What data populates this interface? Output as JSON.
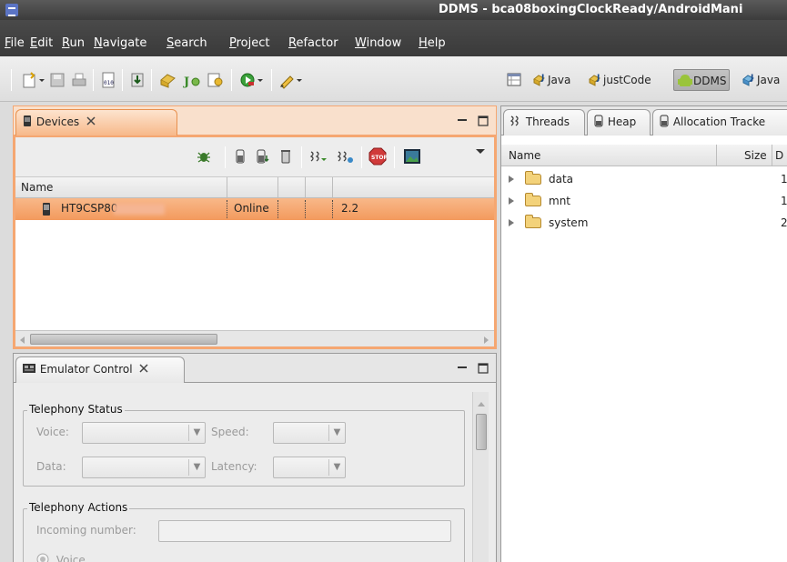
{
  "window": {
    "title": "DDMS - bca08boxingClockReady/AndroidMani"
  },
  "menu": [
    "File",
    "Edit",
    "Run",
    "Navigate",
    "Search",
    "Project",
    "Refactor",
    "Window",
    "Help"
  ],
  "perspectives": [
    "Java",
    "justCode",
    "DDMS",
    "Java"
  ],
  "devices_view": {
    "tab_label": "Devices",
    "column_name": "Name",
    "device": {
      "serial": "HT9CSP80",
      "state": "Online",
      "build": "2.2"
    }
  },
  "emulator_view": {
    "tab_label": "Emulator Control",
    "telephony_status_label": "Telephony Status",
    "voice_label": "Voice:",
    "speed_label": "Speed:",
    "data_label": "Data:",
    "latency_label": "Latency:",
    "telephony_actions_label": "Telephony Actions",
    "incoming_number_label": "Incoming number:",
    "voice_radio_label": "Voice"
  },
  "file_explorer": {
    "tabs": [
      "Threads",
      "Heap",
      "Allocation Tracke"
    ],
    "columns": [
      "Name",
      "Size",
      "D"
    ],
    "rows": [
      {
        "name": "data",
        "extra": "1"
      },
      {
        "name": "mnt",
        "extra": "1"
      },
      {
        "name": "system",
        "extra": "2"
      }
    ]
  },
  "colors": {
    "accent": "#f39a5d",
    "title_bar": "#3c3c3c",
    "folder": "#f3d27a"
  },
  "icons": [
    "new-wizard-icon",
    "save-icon",
    "print-icon",
    "binary-icon",
    "download-icon",
    "new-package-icon",
    "new-java-icon",
    "new-file-icon",
    "run-icon",
    "pen-icon",
    "debug-bug-icon",
    "heap-update-icon",
    "dump-hprof-icon",
    "gc-icon",
    "thread-update-icon",
    "start-method-profiling-icon",
    "stop-process-icon",
    "screen-capture-icon",
    "view-menu-icon",
    "minimize-icon",
    "maximize-icon",
    "phone-icon",
    "emulator-icon",
    "threads-icon",
    "heap-icon",
    "allocation-icon",
    "folder-icon"
  ]
}
